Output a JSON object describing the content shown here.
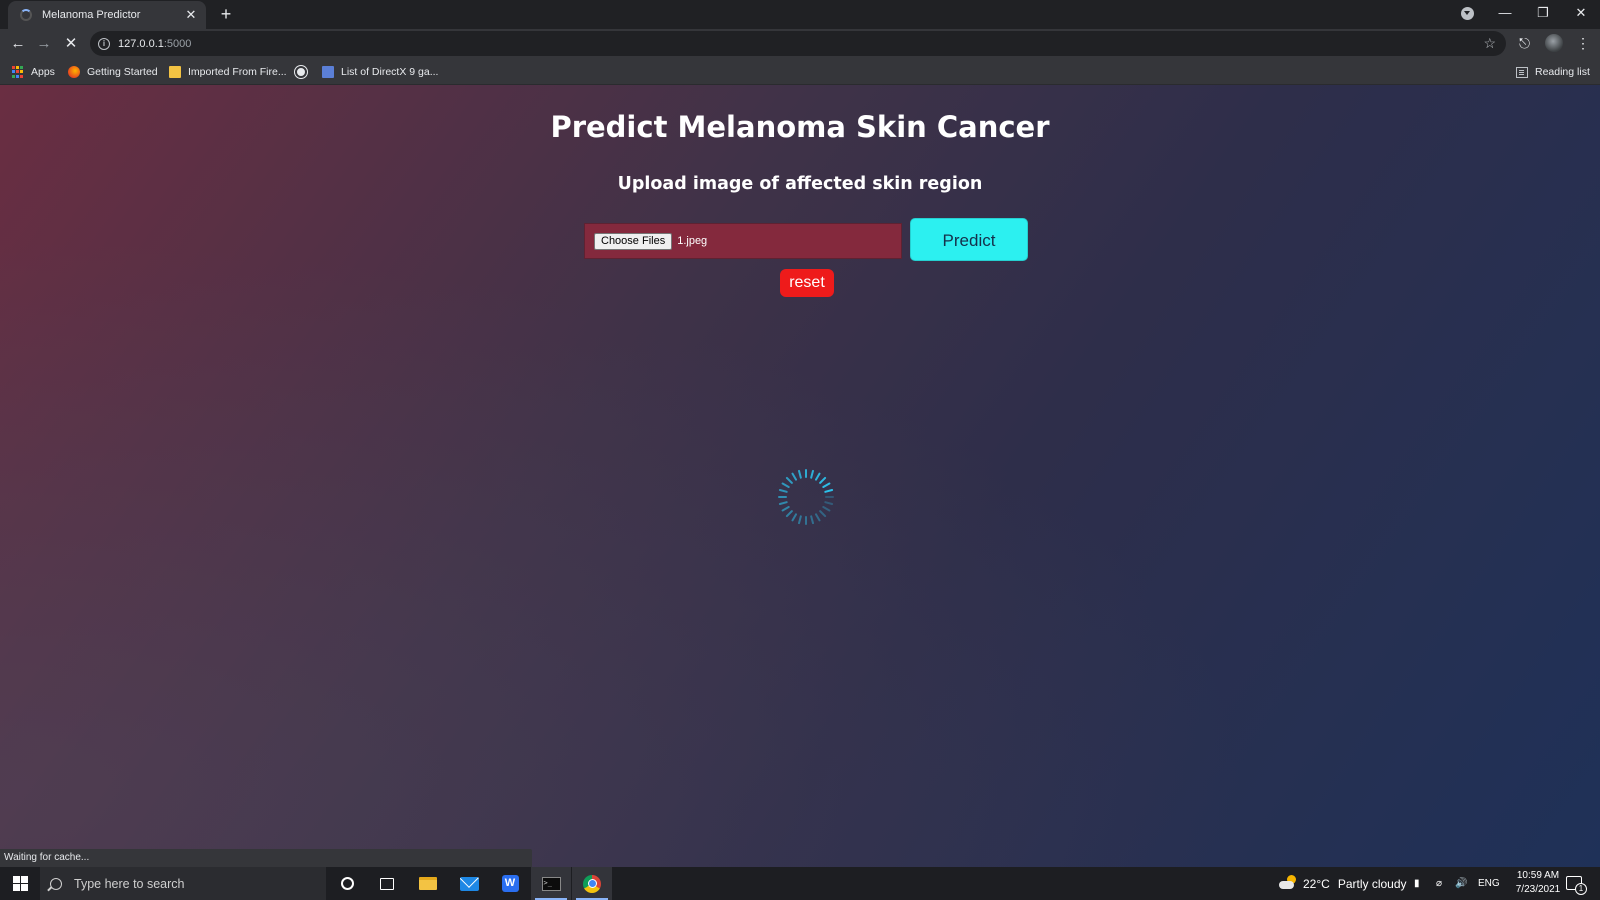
{
  "browser": {
    "tab_title": "Melanoma Predictor",
    "new_tab_symbol": "+",
    "close_symbol": "✕",
    "url_host": "127.0.0.1",
    "url_port": ":5000",
    "bookmarks": [
      {
        "label": "Apps",
        "icon": "apps-grid-icon"
      },
      {
        "label": "Getting Started",
        "icon": "firefox-icon"
      },
      {
        "label": "Imported From Fire...",
        "icon": "folder-icon"
      },
      {
        "label": "",
        "icon": "globe-icon"
      },
      {
        "label": "List of DirectX 9 ga...",
        "icon": "page-icon"
      }
    ],
    "reading_list": "Reading list",
    "status_text": "Waiting for cache..."
  },
  "page": {
    "title": "Predict Melanoma Skin Cancer",
    "subtitle": "Upload image of affected skin region",
    "choose_files_label": "Choose Files",
    "file_name": "1.jpeg",
    "predict_label": "Predict",
    "reset_label": "reset",
    "colors": {
      "predict_bg": "#2cf0f0",
      "reset_bg": "#ee1b1b",
      "file_box_bg": "#84293d",
      "spinner": "#2cc6f0"
    }
  },
  "taskbar": {
    "search_placeholder": "Type here to search",
    "weather_temp": "22°C",
    "weather_desc": "Partly cloudy",
    "language": "ENG",
    "time": "10:59 AM",
    "date": "7/23/2021",
    "notification_count": "1"
  }
}
